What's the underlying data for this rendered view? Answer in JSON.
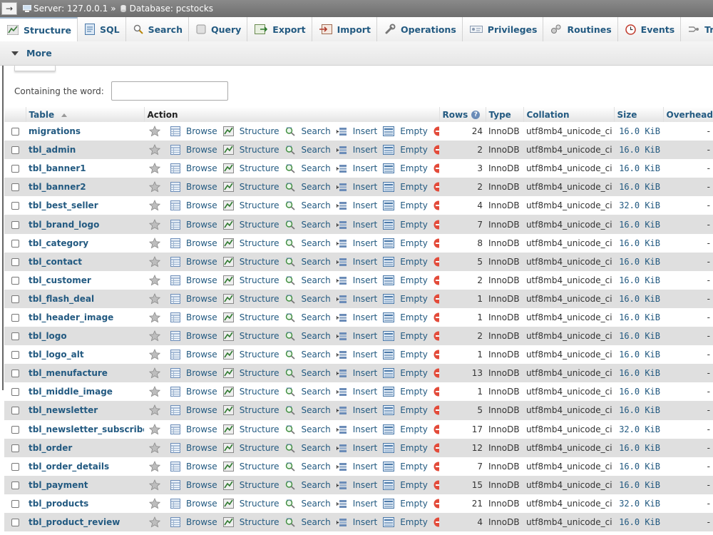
{
  "breadcrumb": {
    "server": "Server: 127.0.0.1",
    "separator": "»",
    "database": "Database: pcstocks"
  },
  "tabs": [
    {
      "label": "Structure",
      "icon": "structure-icon",
      "active": true
    },
    {
      "label": "SQL",
      "icon": "sql-icon"
    },
    {
      "label": "Search",
      "icon": "search-icon"
    },
    {
      "label": "Query",
      "icon": "query-icon"
    },
    {
      "label": "Export",
      "icon": "export-icon"
    },
    {
      "label": "Import",
      "icon": "import-icon"
    },
    {
      "label": "Operations",
      "icon": "wrench-icon"
    },
    {
      "label": "Privileges",
      "icon": "privileges-icon"
    },
    {
      "label": "Routines",
      "icon": "routines-icon"
    },
    {
      "label": "Events",
      "icon": "clock-icon"
    },
    {
      "label": "Trigge",
      "icon": "triggers-icon"
    }
  ],
  "more_label": "More",
  "filter": {
    "label": "Containing the word:",
    "value": ""
  },
  "columns": {
    "table": "Table",
    "action": "Action",
    "rows": "Rows",
    "type": "Type",
    "collation": "Collation",
    "size": "Size",
    "overhead": "Overhead"
  },
  "actions": {
    "browse": "Browse",
    "structure": "Structure",
    "search": "Search",
    "insert": "Insert",
    "empty": "Empty",
    "drop": "Drop"
  },
  "rows": [
    {
      "name": "migrations",
      "rows": "24",
      "type": "InnoDB",
      "collation": "utf8mb4_unicode_ci",
      "size": "16.0 KiB",
      "overhead": "-"
    },
    {
      "name": "tbl_admin",
      "rows": "2",
      "type": "InnoDB",
      "collation": "utf8mb4_unicode_ci",
      "size": "16.0 KiB",
      "overhead": "-"
    },
    {
      "name": "tbl_banner1",
      "rows": "3",
      "type": "InnoDB",
      "collation": "utf8mb4_unicode_ci",
      "size": "16.0 KiB",
      "overhead": "-"
    },
    {
      "name": "tbl_banner2",
      "rows": "2",
      "type": "InnoDB",
      "collation": "utf8mb4_unicode_ci",
      "size": "16.0 KiB",
      "overhead": "-"
    },
    {
      "name": "tbl_best_seller",
      "rows": "4",
      "type": "InnoDB",
      "collation": "utf8mb4_unicode_ci",
      "size": "32.0 KiB",
      "overhead": "-"
    },
    {
      "name": "tbl_brand_logo",
      "rows": "7",
      "type": "InnoDB",
      "collation": "utf8mb4_unicode_ci",
      "size": "16.0 KiB",
      "overhead": "-"
    },
    {
      "name": "tbl_category",
      "rows": "8",
      "type": "InnoDB",
      "collation": "utf8mb4_unicode_ci",
      "size": "16.0 KiB",
      "overhead": "-"
    },
    {
      "name": "tbl_contact",
      "rows": "5",
      "type": "InnoDB",
      "collation": "utf8mb4_unicode_ci",
      "size": "16.0 KiB",
      "overhead": "-"
    },
    {
      "name": "tbl_customer",
      "rows": "2",
      "type": "InnoDB",
      "collation": "utf8mb4_unicode_ci",
      "size": "16.0 KiB",
      "overhead": "-"
    },
    {
      "name": "tbl_flash_deal",
      "rows": "1",
      "type": "InnoDB",
      "collation": "utf8mb4_unicode_ci",
      "size": "16.0 KiB",
      "overhead": "-"
    },
    {
      "name": "tbl_header_image",
      "rows": "1",
      "type": "InnoDB",
      "collation": "utf8mb4_unicode_ci",
      "size": "16.0 KiB",
      "overhead": "-"
    },
    {
      "name": "tbl_logo",
      "rows": "2",
      "type": "InnoDB",
      "collation": "utf8mb4_unicode_ci",
      "size": "16.0 KiB",
      "overhead": "-"
    },
    {
      "name": "tbl_logo_alt",
      "rows": "1",
      "type": "InnoDB",
      "collation": "utf8mb4_unicode_ci",
      "size": "16.0 KiB",
      "overhead": "-"
    },
    {
      "name": "tbl_menufacture",
      "rows": "13",
      "type": "InnoDB",
      "collation": "utf8mb4_unicode_ci",
      "size": "16.0 KiB",
      "overhead": "-"
    },
    {
      "name": "tbl_middle_image",
      "rows": "1",
      "type": "InnoDB",
      "collation": "utf8mb4_unicode_ci",
      "size": "16.0 KiB",
      "overhead": "-"
    },
    {
      "name": "tbl_newsletter",
      "rows": "5",
      "type": "InnoDB",
      "collation": "utf8mb4_unicode_ci",
      "size": "16.0 KiB",
      "overhead": "-"
    },
    {
      "name": "tbl_newsletter_subscriber",
      "rows": "17",
      "type": "InnoDB",
      "collation": "utf8mb4_unicode_ci",
      "size": "32.0 KiB",
      "overhead": "-"
    },
    {
      "name": "tbl_order",
      "rows": "12",
      "type": "InnoDB",
      "collation": "utf8mb4_unicode_ci",
      "size": "16.0 KiB",
      "overhead": "-"
    },
    {
      "name": "tbl_order_details",
      "rows": "7",
      "type": "InnoDB",
      "collation": "utf8mb4_unicode_ci",
      "size": "16.0 KiB",
      "overhead": "-"
    },
    {
      "name": "tbl_payment",
      "rows": "15",
      "type": "InnoDB",
      "collation": "utf8mb4_unicode_ci",
      "size": "16.0 KiB",
      "overhead": "-"
    },
    {
      "name": "tbl_products",
      "rows": "21",
      "type": "InnoDB",
      "collation": "utf8mb4_unicode_ci",
      "size": "32.0 KiB",
      "overhead": "-"
    },
    {
      "name": "tbl_product_review",
      "rows": "4",
      "type": "InnoDB",
      "collation": "utf8mb4_unicode_ci",
      "size": "16.0 KiB",
      "overhead": "-"
    }
  ]
}
